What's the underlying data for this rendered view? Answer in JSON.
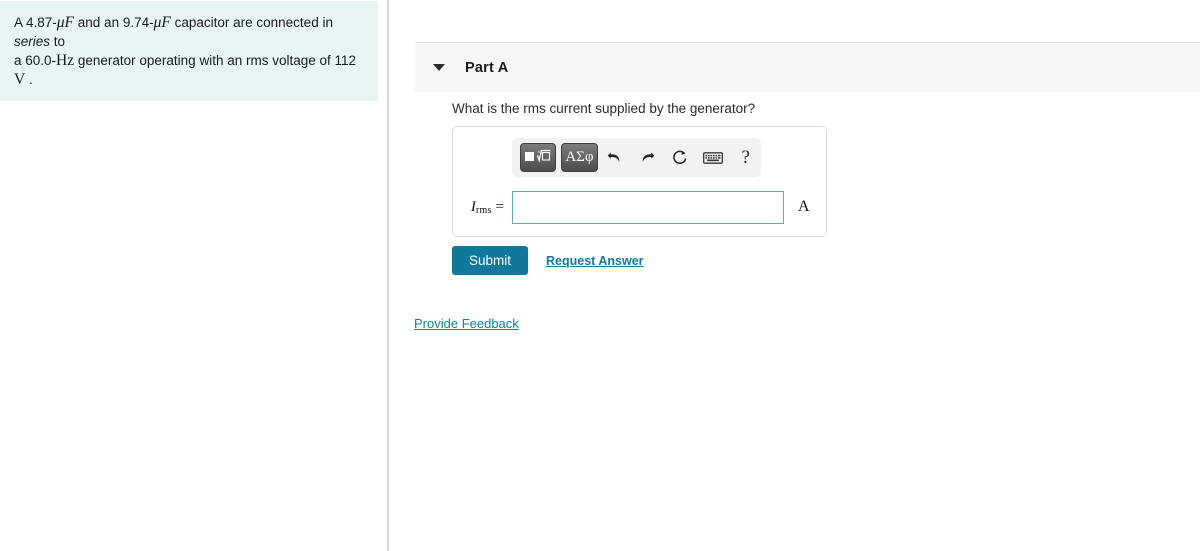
{
  "problem": {
    "line1_a": "A 4.87-",
    "line1_unit1": "μF",
    "line1_b": " and an 9.74-",
    "line1_unit2": "μF",
    "line1_c": " capacitor are connected in ",
    "line1_emph": "series",
    "line1_d": " to",
    "line2_a": "a 60.0-",
    "line2_unit1": "Hz",
    "line2_b": " generator operating with an rms voltage of 112 ",
    "line2_unit2": "V",
    "line2_c": " ."
  },
  "part": {
    "title": "Part A",
    "caret_icon": "caret-down-icon",
    "question": "What is the rms current supplied by the generator?"
  },
  "toolbar": {
    "template_button": {
      "name": "math-template-button",
      "glyph": "■√□"
    },
    "greek_button": {
      "name": "greek-letters-button",
      "label": "ΑΣφ"
    },
    "undo": "undo-icon",
    "redo": "redo-icon",
    "reset": "reset-icon",
    "keyboard": "keyboard-icon",
    "help": "?"
  },
  "answer": {
    "label_symbol": "I",
    "label_subscript": "rms",
    "label_equals": " =",
    "value": "",
    "placeholder": "",
    "unit": "A"
  },
  "actions": {
    "submit_label": "Submit",
    "request_answer_label": "Request Answer",
    "provide_feedback_label": "Provide Feedback"
  },
  "colors": {
    "accent_teal": "#11789c",
    "link_teal": "#0f7fa3",
    "problem_bg": "#e7f4f2",
    "header_bg": "#f7f7f7",
    "input_border": "#61a8c4"
  }
}
